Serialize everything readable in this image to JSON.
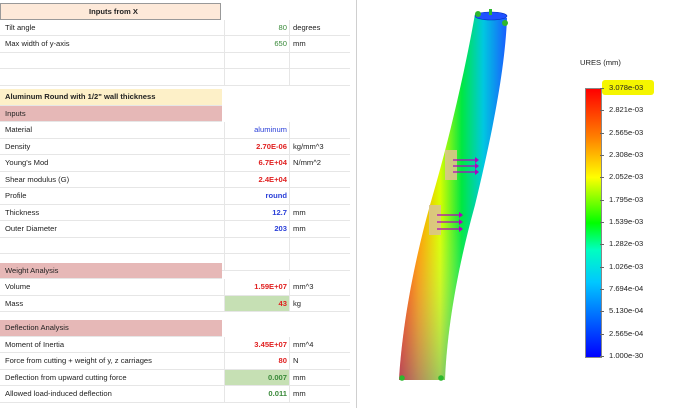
{
  "sheet": {
    "title": "Inputs from X",
    "tilt_angle": {
      "label": "Tilt angle",
      "value": "80",
      "unit": "degrees"
    },
    "max_width": {
      "label": "Max width of y-axis",
      "value": "650",
      "unit": "mm"
    },
    "section_title": "Aluminum Round with 1/2\" wall thickness",
    "inputs_header": "Inputs",
    "material": {
      "label": "Material",
      "value": "aluminum"
    },
    "density": {
      "label": "Density",
      "value": "2.70E-06",
      "unit": "kg/mm^3"
    },
    "youngs": {
      "label": "Young's Mod",
      "value": "6.7E+04",
      "unit": "N/mm^2"
    },
    "shear": {
      "label": "Shear modulus (G)",
      "value": "2.4E+04"
    },
    "profile": {
      "label": "Profile",
      "value": "round"
    },
    "thickness": {
      "label": "Thickness",
      "value": "12.7",
      "unit": "mm"
    },
    "outer_diameter": {
      "label": "Outer Diameter",
      "value": "203",
      "unit": "mm"
    },
    "weight_header": "Weight Analysis",
    "volume": {
      "label": "Volume",
      "value": "1.59E+07",
      "unit": "mm^3"
    },
    "mass": {
      "label": "Mass",
      "value": "43",
      "unit": "kg"
    },
    "deflection_header": "Deflection Analysis",
    "moment": {
      "label": "Moment of Inertia",
      "value": "3.45E+07",
      "unit": "mm^4"
    },
    "force": {
      "label": "Force from cutting + weight of y, z carriages",
      "value": "80",
      "unit": "N"
    },
    "deflection": {
      "label": "Deflection from upward cutting force",
      "value": "0.007",
      "unit": "mm"
    },
    "allowed": {
      "label": "Allowed load-induced deflection",
      "value": "0.011",
      "unit": "mm"
    }
  },
  "legend": {
    "title": "URES (mm)",
    "labels": [
      "3.078e-03",
      "2.821e-03",
      "2.565e-03",
      "2.308e-03",
      "2.052e-03",
      "1.795e-03",
      "1.539e-03",
      "1.282e-03",
      "1.026e-03",
      "7.694e-04",
      "5.130e-04",
      "2.565e-04",
      "1.000e-30"
    ]
  },
  "colors": {
    "max_highlight": "#f5f500",
    "green_cell": "#c6e0b4",
    "pink_header": "#e6b8b7"
  }
}
